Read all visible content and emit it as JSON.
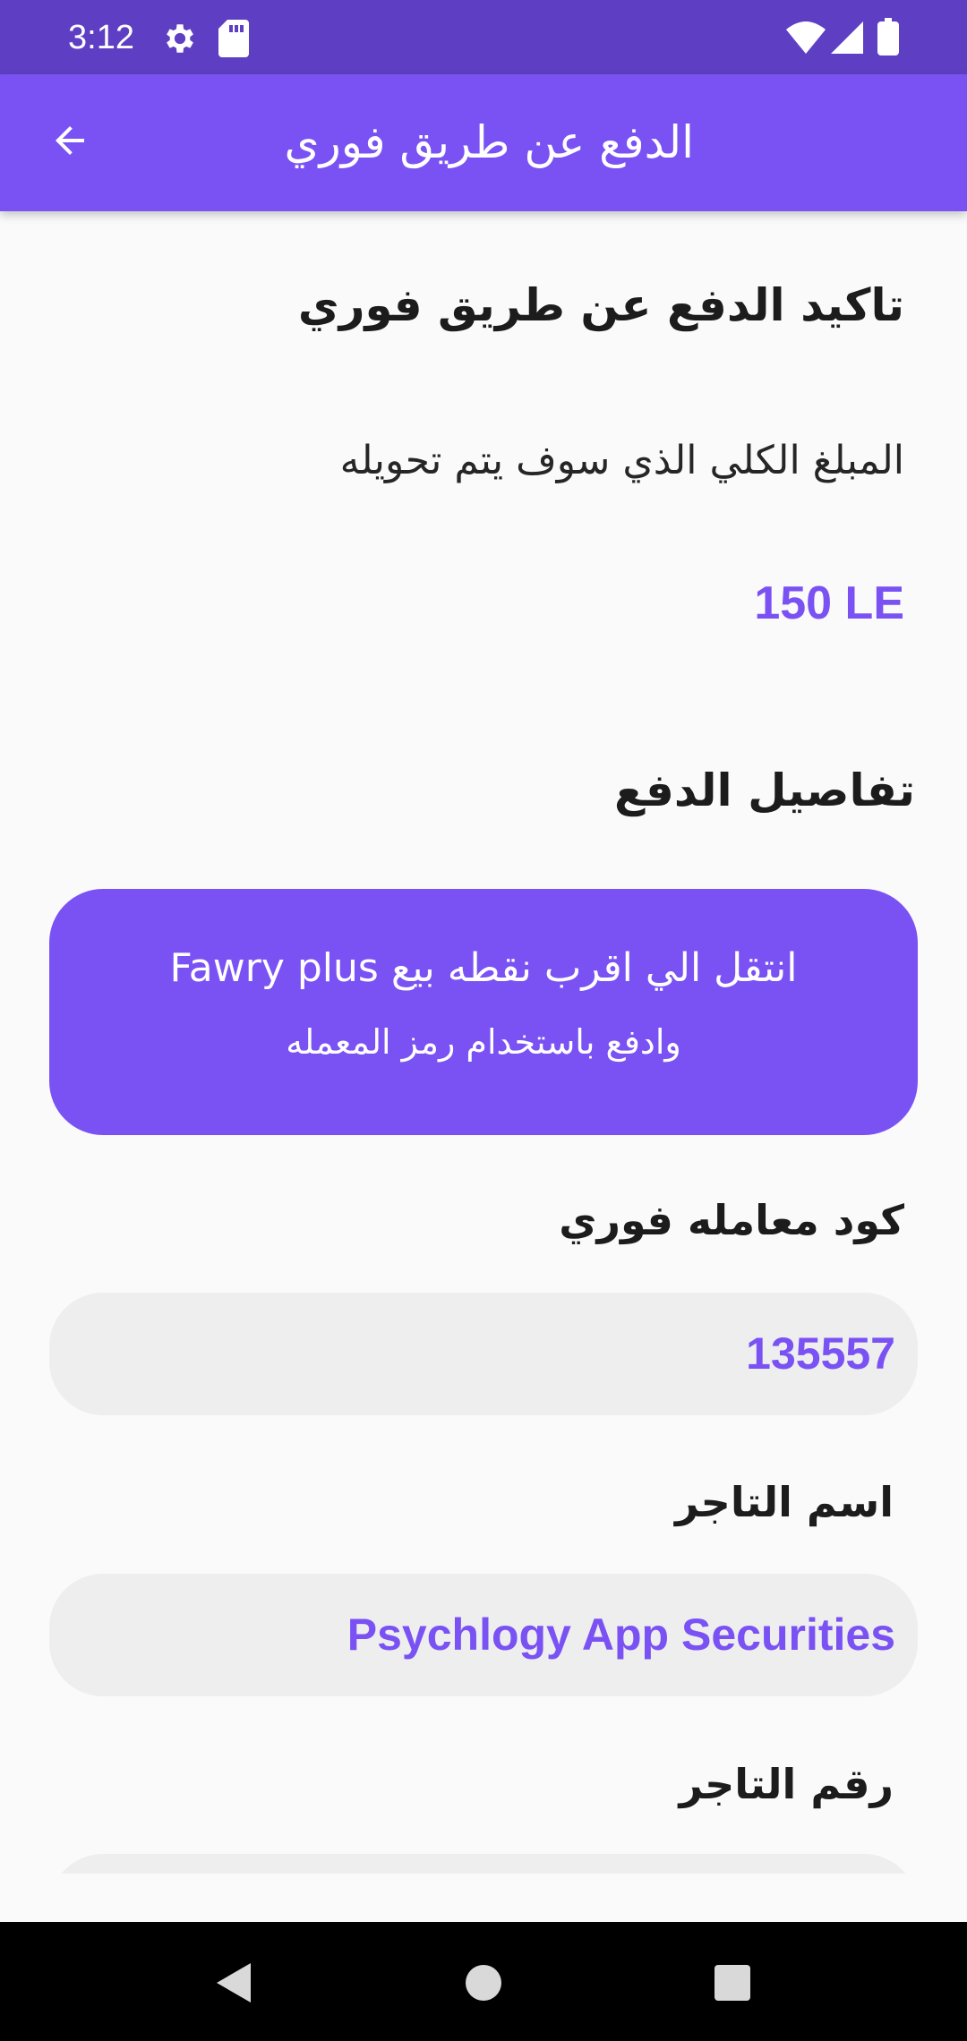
{
  "status_bar": {
    "time": "3:12",
    "icons": [
      "gear-icon",
      "sd-card-icon",
      "wifi-icon",
      "signal-icon",
      "battery-icon"
    ]
  },
  "app_bar": {
    "title": "الدفع عن طريق فوري",
    "back_icon": "arrow-back-icon"
  },
  "confirmation": {
    "title": "تاكيد الدفع عن طريق فوري",
    "total_label": "المبلغ الكلي الذي سوف يتم تحويله",
    "amount": "150 LE"
  },
  "payment_details": {
    "title": "تفاصيل الدفع",
    "instruction_line1": "انتقل الي اقرب نقطه بيع  Fawry plus",
    "instruction_line2": "وادفع باستخدام رمز المعمله"
  },
  "fields": {
    "transaction_code_label": "كود معامله فوري",
    "transaction_code_value": "135557",
    "merchant_name_label": "اسم التاجر",
    "merchant_name_value": "Psychlogy App Securities",
    "merchant_number_label": "رقم التاجر",
    "merchant_number_value": ""
  },
  "nav_bar": {
    "icons": [
      "back-triangle-icon",
      "home-circle-icon",
      "recents-square-icon"
    ]
  },
  "colors": {
    "status_bar": "#5e3fc4",
    "accent": "#7a52f4",
    "background": "#fafafa",
    "field_background": "#eeeeee"
  }
}
